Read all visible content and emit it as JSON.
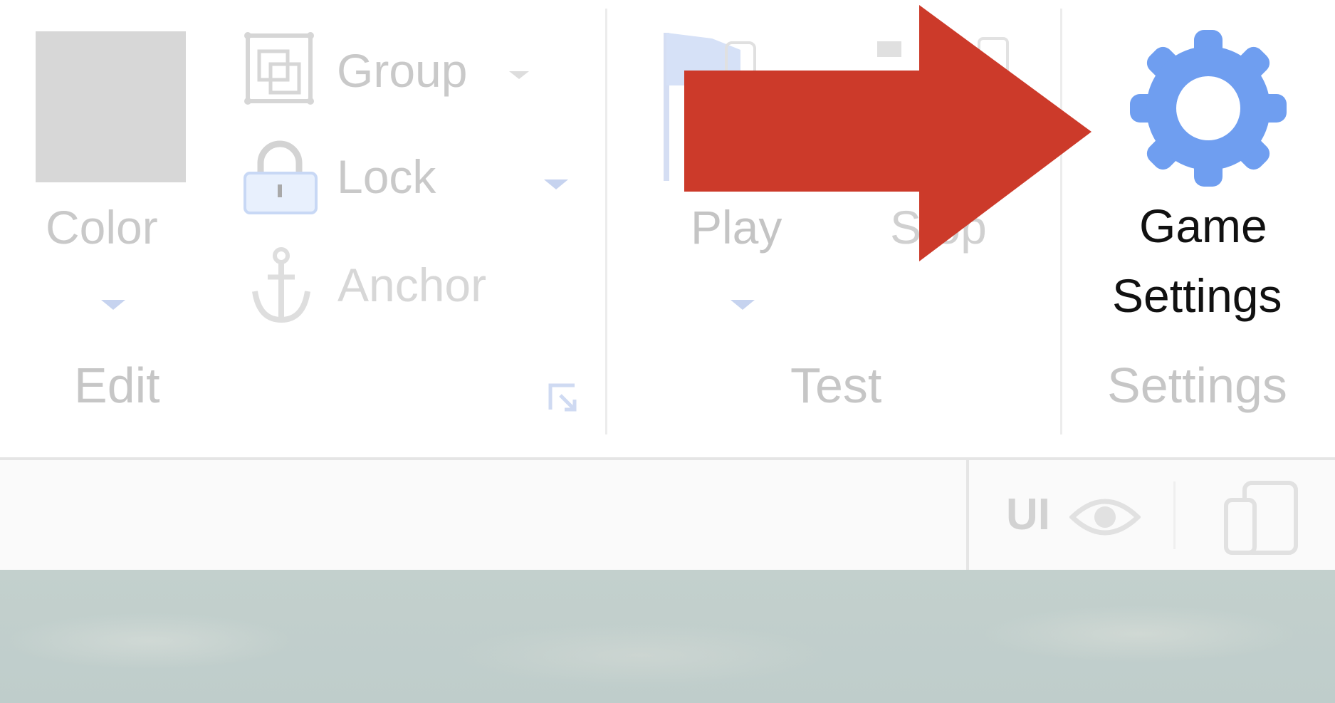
{
  "ribbon": {
    "edit": {
      "color_label": "Color",
      "group_label": "Group",
      "lock_label": "Lock",
      "anchor_label": "Anchor",
      "section_label": "Edit"
    },
    "test": {
      "play_label": "Play",
      "stop_label": "Stop",
      "section_label": "Test"
    },
    "settings": {
      "game_settings_line1": "Game",
      "game_settings_line2": "Settings",
      "section_label": "Settings"
    }
  },
  "toolbar": {
    "ui_toggle_label": "UI"
  },
  "colors": {
    "accent_blue": "#6f9ef0",
    "arrow_red": "#cc3a2a",
    "faded_text": "#c9c9c9"
  }
}
